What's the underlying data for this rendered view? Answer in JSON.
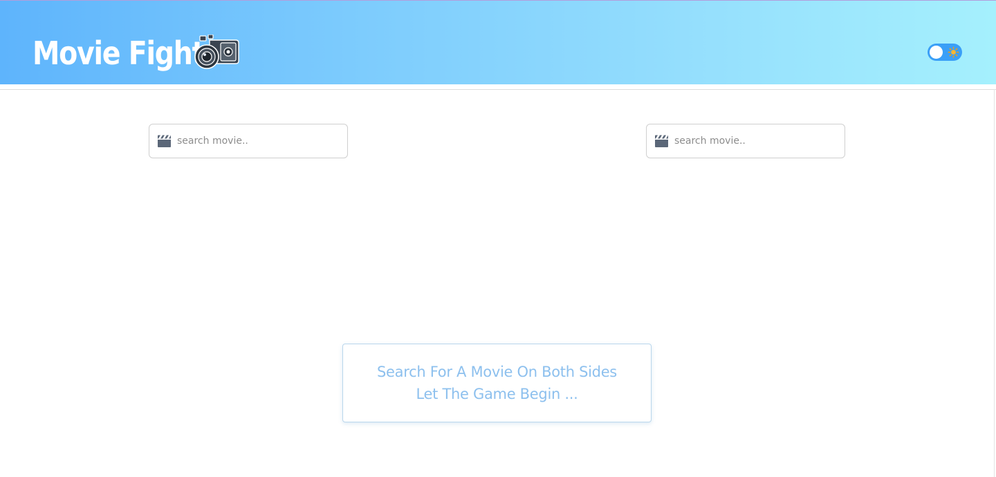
{
  "header": {
    "title": "Movie Fight",
    "logo_icon": "camera-icon",
    "theme_toggle": {
      "state": "off",
      "icon": "sun-icon",
      "track_color": "#3a9ff7"
    },
    "gradient": [
      "#5eb4fc",
      "#a5f0fd"
    ]
  },
  "search": {
    "left": {
      "placeholder": "search movie..",
      "value": "",
      "icon": "clapperboard-icon"
    },
    "right": {
      "placeholder": "search movie..",
      "value": "",
      "icon": "clapperboard-icon"
    }
  },
  "prompt": {
    "line1": "Search For A Movie On Both Sides",
    "line2": "Let The Game Begin ...",
    "text_color": "#8dc0ee"
  }
}
